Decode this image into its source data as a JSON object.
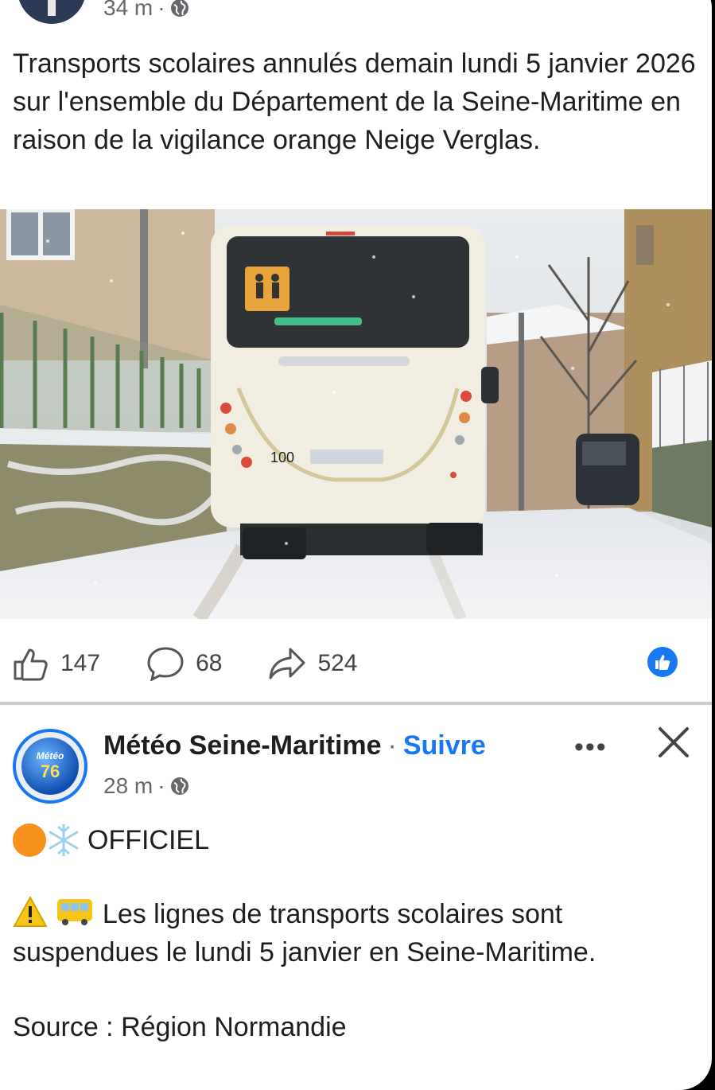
{
  "post1": {
    "time": "34 m",
    "text": "Transports scolaires annulés demain lundi 5 janvier 2026 sur l'ensemble du Département de la Seine-Maritime en raison de la vigilance orange Neige Verglas.",
    "bus_number": "100",
    "likes": "147",
    "comments": "68",
    "shares": "524"
  },
  "post2": {
    "page_name": "Météo Seine-Maritime",
    "separator": "·",
    "follow_label": "Suivre",
    "more_label": "•••",
    "time": "28 m",
    "avatar_text_top": "Météo",
    "avatar_text_bottom": "76",
    "tag": "OFFICIEL",
    "body": "Les lignes de transports scolaires sont suspendues le lundi 5 janvier en Seine-Maritime.",
    "source": "Source : Région Normandie"
  },
  "colors": {
    "accent": "#1877f2",
    "meta_grey": "#65676b",
    "orange": "#f7911e"
  },
  "icons": [
    "globe-icon",
    "like-icon",
    "comment-icon",
    "share-icon",
    "like-badge-icon",
    "close-icon",
    "more-icon",
    "warning-icon",
    "bus-icon",
    "snowflake-icon"
  ]
}
